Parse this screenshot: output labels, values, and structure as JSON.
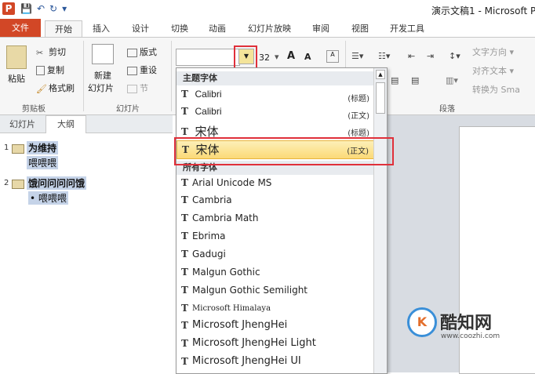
{
  "window": {
    "title": "演示文稿1 - Microsoft P"
  },
  "qat": {
    "app_letter": "P",
    "save": "💾",
    "undo": "↶",
    "redo": "↻",
    "more": "▾"
  },
  "tabs": [
    "文件",
    "开始",
    "插入",
    "设计",
    "切换",
    "动画",
    "幻灯片放映",
    "审阅",
    "视图",
    "开发工具"
  ],
  "ribbon": {
    "clipboard": {
      "paste": "粘贴",
      "cut": "剪切",
      "copy": "复制",
      "format_painter": "格式刷",
      "group": "剪贴板"
    },
    "slides": {
      "new_slide": "新建",
      "new_slide2": "幻灯片",
      "layout": "版式",
      "reset": "重设",
      "section": "节",
      "group": "幻灯片"
    },
    "font": {
      "size": "32",
      "grow": "A",
      "shrink": "A"
    },
    "paragraph": {
      "text_direction": "文字方向",
      "align_text": "对齐文本",
      "convert_smartart": "转换为 Sma",
      "group": "段落"
    }
  },
  "pane": {
    "tab_slides": "幻灯片",
    "tab_outline": "大纲"
  },
  "outline": [
    {
      "num": "1",
      "title": "为维持",
      "body": "喂喂喂"
    },
    {
      "num": "2",
      "title": "饿问问问问饿",
      "body": "喂喂喂"
    }
  ],
  "font_dropdown": {
    "theme_header": "主题字体",
    "theme_fonts": [
      {
        "name": "Calibri",
        "tag": "(标题)"
      },
      {
        "name": "Calibri",
        "tag": "(正文)"
      },
      {
        "name": "宋体",
        "tag": "(标题)"
      },
      {
        "name": "宋体",
        "tag": "(正文)"
      }
    ],
    "all_header": "所有字体",
    "all_fonts": [
      "Arial Unicode MS",
      "Cambria",
      "Cambria Math",
      "Ebrima",
      "Gadugi",
      "Malgun Gothic",
      "Malgun Gothic Semilight",
      "Microsoft Himalaya",
      "Microsoft JhengHei",
      "Microsoft JhengHei Light",
      "Microsoft JhengHei UI"
    ]
  },
  "watermark": {
    "logo": "K",
    "name": "酷知网",
    "url": "www.coozhi.com"
  },
  "colors": {
    "accent": "#d24726",
    "highlight": "#e0303a",
    "selection": "#fbd977"
  }
}
